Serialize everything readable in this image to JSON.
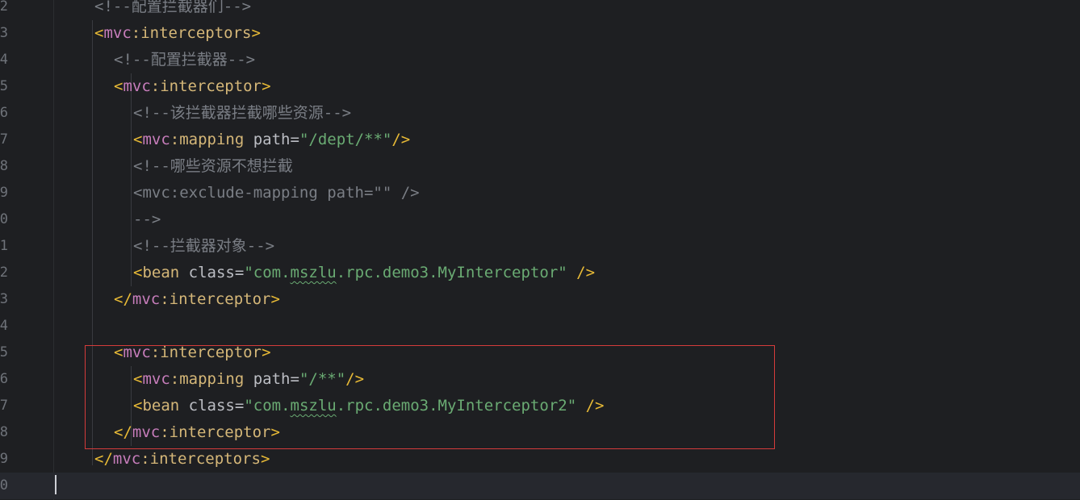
{
  "editor": {
    "lines": [
      {
        "num": "2",
        "indent": 2,
        "tokens": [
          {
            "t": "cmt",
            "v": "<!--配置拦截器们-->"
          }
        ]
      },
      {
        "num": "3",
        "indent": 2,
        "tokens": [
          {
            "t": "br",
            "v": "<"
          },
          {
            "t": "ns",
            "v": "mvc"
          },
          {
            "t": "tag",
            "v": ":interceptors"
          },
          {
            "t": "br",
            "v": ">"
          }
        ]
      },
      {
        "num": "4",
        "indent": 3,
        "tokens": [
          {
            "t": "cmt",
            "v": "<!--配置拦截器-->"
          }
        ]
      },
      {
        "num": "5",
        "indent": 3,
        "tokens": [
          {
            "t": "br",
            "v": "<"
          },
          {
            "t": "ns",
            "v": "mvc"
          },
          {
            "t": "tag",
            "v": ":interceptor"
          },
          {
            "t": "br",
            "v": ">"
          }
        ]
      },
      {
        "num": "6",
        "indent": 4,
        "tokens": [
          {
            "t": "cmt",
            "v": "<!--该拦截器拦截哪些资源-->"
          }
        ]
      },
      {
        "num": "7",
        "indent": 4,
        "tokens": [
          {
            "t": "br",
            "v": "<"
          },
          {
            "t": "ns",
            "v": "mvc"
          },
          {
            "t": "tag",
            "v": ":mapping"
          },
          {
            "t": "attr",
            "v": " path"
          },
          {
            "t": "eq",
            "v": "="
          },
          {
            "t": "str",
            "v": "\"/dept/**\""
          },
          {
            "t": "br",
            "v": "/>"
          }
        ]
      },
      {
        "num": "8",
        "indent": 4,
        "tokens": [
          {
            "t": "cmt",
            "v": "<!--哪些资源不想拦截"
          }
        ]
      },
      {
        "num": "9",
        "indent": 4,
        "tokens": [
          {
            "t": "cmt",
            "v": "<mvc:exclude-mapping path=\"\" />"
          }
        ]
      },
      {
        "num": "0",
        "indent": 4,
        "tokens": [
          {
            "t": "cmt",
            "v": "-->"
          }
        ]
      },
      {
        "num": "1",
        "indent": 4,
        "tokens": [
          {
            "t": "cmt",
            "v": "<!--拦截器对象-->"
          }
        ]
      },
      {
        "num": "2",
        "indent": 4,
        "tokens": [
          {
            "t": "br",
            "v": "<"
          },
          {
            "t": "tag",
            "v": "bean"
          },
          {
            "t": "attr",
            "v": " class"
          },
          {
            "t": "eq",
            "v": "="
          },
          {
            "t": "str",
            "v": "\"com."
          },
          {
            "t": "strsq",
            "v": "mszlu"
          },
          {
            "t": "str",
            "v": ".rpc.demo3.MyInterceptor\""
          },
          {
            "t": "br",
            "v": " />"
          }
        ]
      },
      {
        "num": "3",
        "indent": 3,
        "tokens": [
          {
            "t": "br",
            "v": "</"
          },
          {
            "t": "ns",
            "v": "mvc"
          },
          {
            "t": "tag",
            "v": ":interceptor"
          },
          {
            "t": "br",
            "v": ">"
          }
        ]
      },
      {
        "num": "4",
        "indent": 0,
        "tokens": []
      },
      {
        "num": "5",
        "indent": 3,
        "tokens": [
          {
            "t": "br",
            "v": "<"
          },
          {
            "t": "ns",
            "v": "mvc"
          },
          {
            "t": "tag",
            "v": ":interceptor"
          },
          {
            "t": "br",
            "v": ">"
          }
        ]
      },
      {
        "num": "6",
        "indent": 4,
        "tokens": [
          {
            "t": "br",
            "v": "<"
          },
          {
            "t": "ns",
            "v": "mvc"
          },
          {
            "t": "tag",
            "v": ":mapping"
          },
          {
            "t": "attr",
            "v": " path"
          },
          {
            "t": "eq",
            "v": "="
          },
          {
            "t": "str",
            "v": "\"/**\""
          },
          {
            "t": "br",
            "v": "/>"
          }
        ]
      },
      {
        "num": "7",
        "indent": 4,
        "tokens": [
          {
            "t": "br",
            "v": "<"
          },
          {
            "t": "tag",
            "v": "bean"
          },
          {
            "t": "attr",
            "v": " class"
          },
          {
            "t": "eq",
            "v": "="
          },
          {
            "t": "str",
            "v": "\"com."
          },
          {
            "t": "strsq",
            "v": "mszlu"
          },
          {
            "t": "str",
            "v": ".rpc.demo3.MyInterceptor2\""
          },
          {
            "t": "br",
            "v": " />"
          }
        ]
      },
      {
        "num": "8",
        "indent": 3,
        "tokens": [
          {
            "t": "br",
            "v": "</"
          },
          {
            "t": "ns",
            "v": "mvc"
          },
          {
            "t": "tag",
            "v": ":interceptor"
          },
          {
            "t": "br",
            "v": ">"
          }
        ]
      },
      {
        "num": "9",
        "indent": 2,
        "tokens": [
          {
            "t": "br",
            "v": "</"
          },
          {
            "t": "ns",
            "v": "mvc"
          },
          {
            "t": "tag",
            "v": ":interceptors"
          },
          {
            "t": "br",
            "v": ">"
          }
        ]
      },
      {
        "num": "0",
        "indent": 0,
        "tokens": [],
        "current": true
      }
    ]
  },
  "colors": {
    "background": "#1e1f22",
    "comment": "#7a7e85",
    "bracket": "#e8ba36",
    "namespace": "#c77dbb",
    "tag": "#d5b778",
    "string": "#6aab73",
    "highlight_box": "#d53b3b"
  }
}
